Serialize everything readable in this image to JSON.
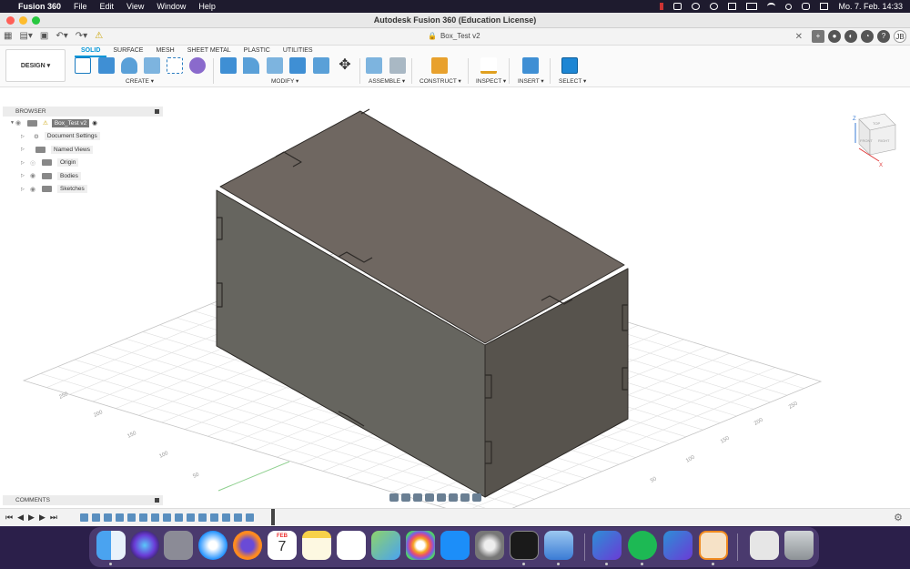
{
  "menubar": {
    "app": "Fusion 360",
    "items": [
      "File",
      "Edit",
      "View",
      "Window",
      "Help"
    ],
    "clock": "Mo. 7. Feb.  14:33"
  },
  "window": {
    "title": "Autodesk Fusion 360 (Education License)",
    "doc_tab": "Box_Test v2"
  },
  "user_initials": "JB",
  "ribbon": {
    "workspace": "DESIGN",
    "tabs": [
      "SOLID",
      "SURFACE",
      "MESH",
      "SHEET METAL",
      "PLASTIC",
      "UTILITIES"
    ],
    "active_tab": "SOLID",
    "groups": [
      "CREATE",
      "MODIFY",
      "ASSEMBLE",
      "CONSTRUCT",
      "INSPECT",
      "INSERT",
      "SELECT"
    ]
  },
  "browser": {
    "title": "BROWSER",
    "root": "Box_Test v2",
    "items": [
      "Document Settings",
      "Named Views",
      "Origin",
      "Bodies",
      "Sketches"
    ]
  },
  "comments": {
    "title": "COMMENTS"
  },
  "viewcube": {
    "faces": [
      "TOP",
      "FRONT",
      "RIGHT"
    ],
    "axes": [
      "Z",
      "X"
    ]
  },
  "grid_labels": {
    "left": [
      "250",
      "200",
      "150",
      "100",
      "50"
    ],
    "right": [
      "250",
      "200",
      "150",
      "100",
      "50"
    ]
  },
  "dock": {
    "calendar_month": "FEB",
    "calendar_day": "7"
  },
  "colors": {
    "accent": "#0696d7",
    "box_top": "#6f6761",
    "box_front": "#66655f",
    "box_side": "#57534d"
  }
}
